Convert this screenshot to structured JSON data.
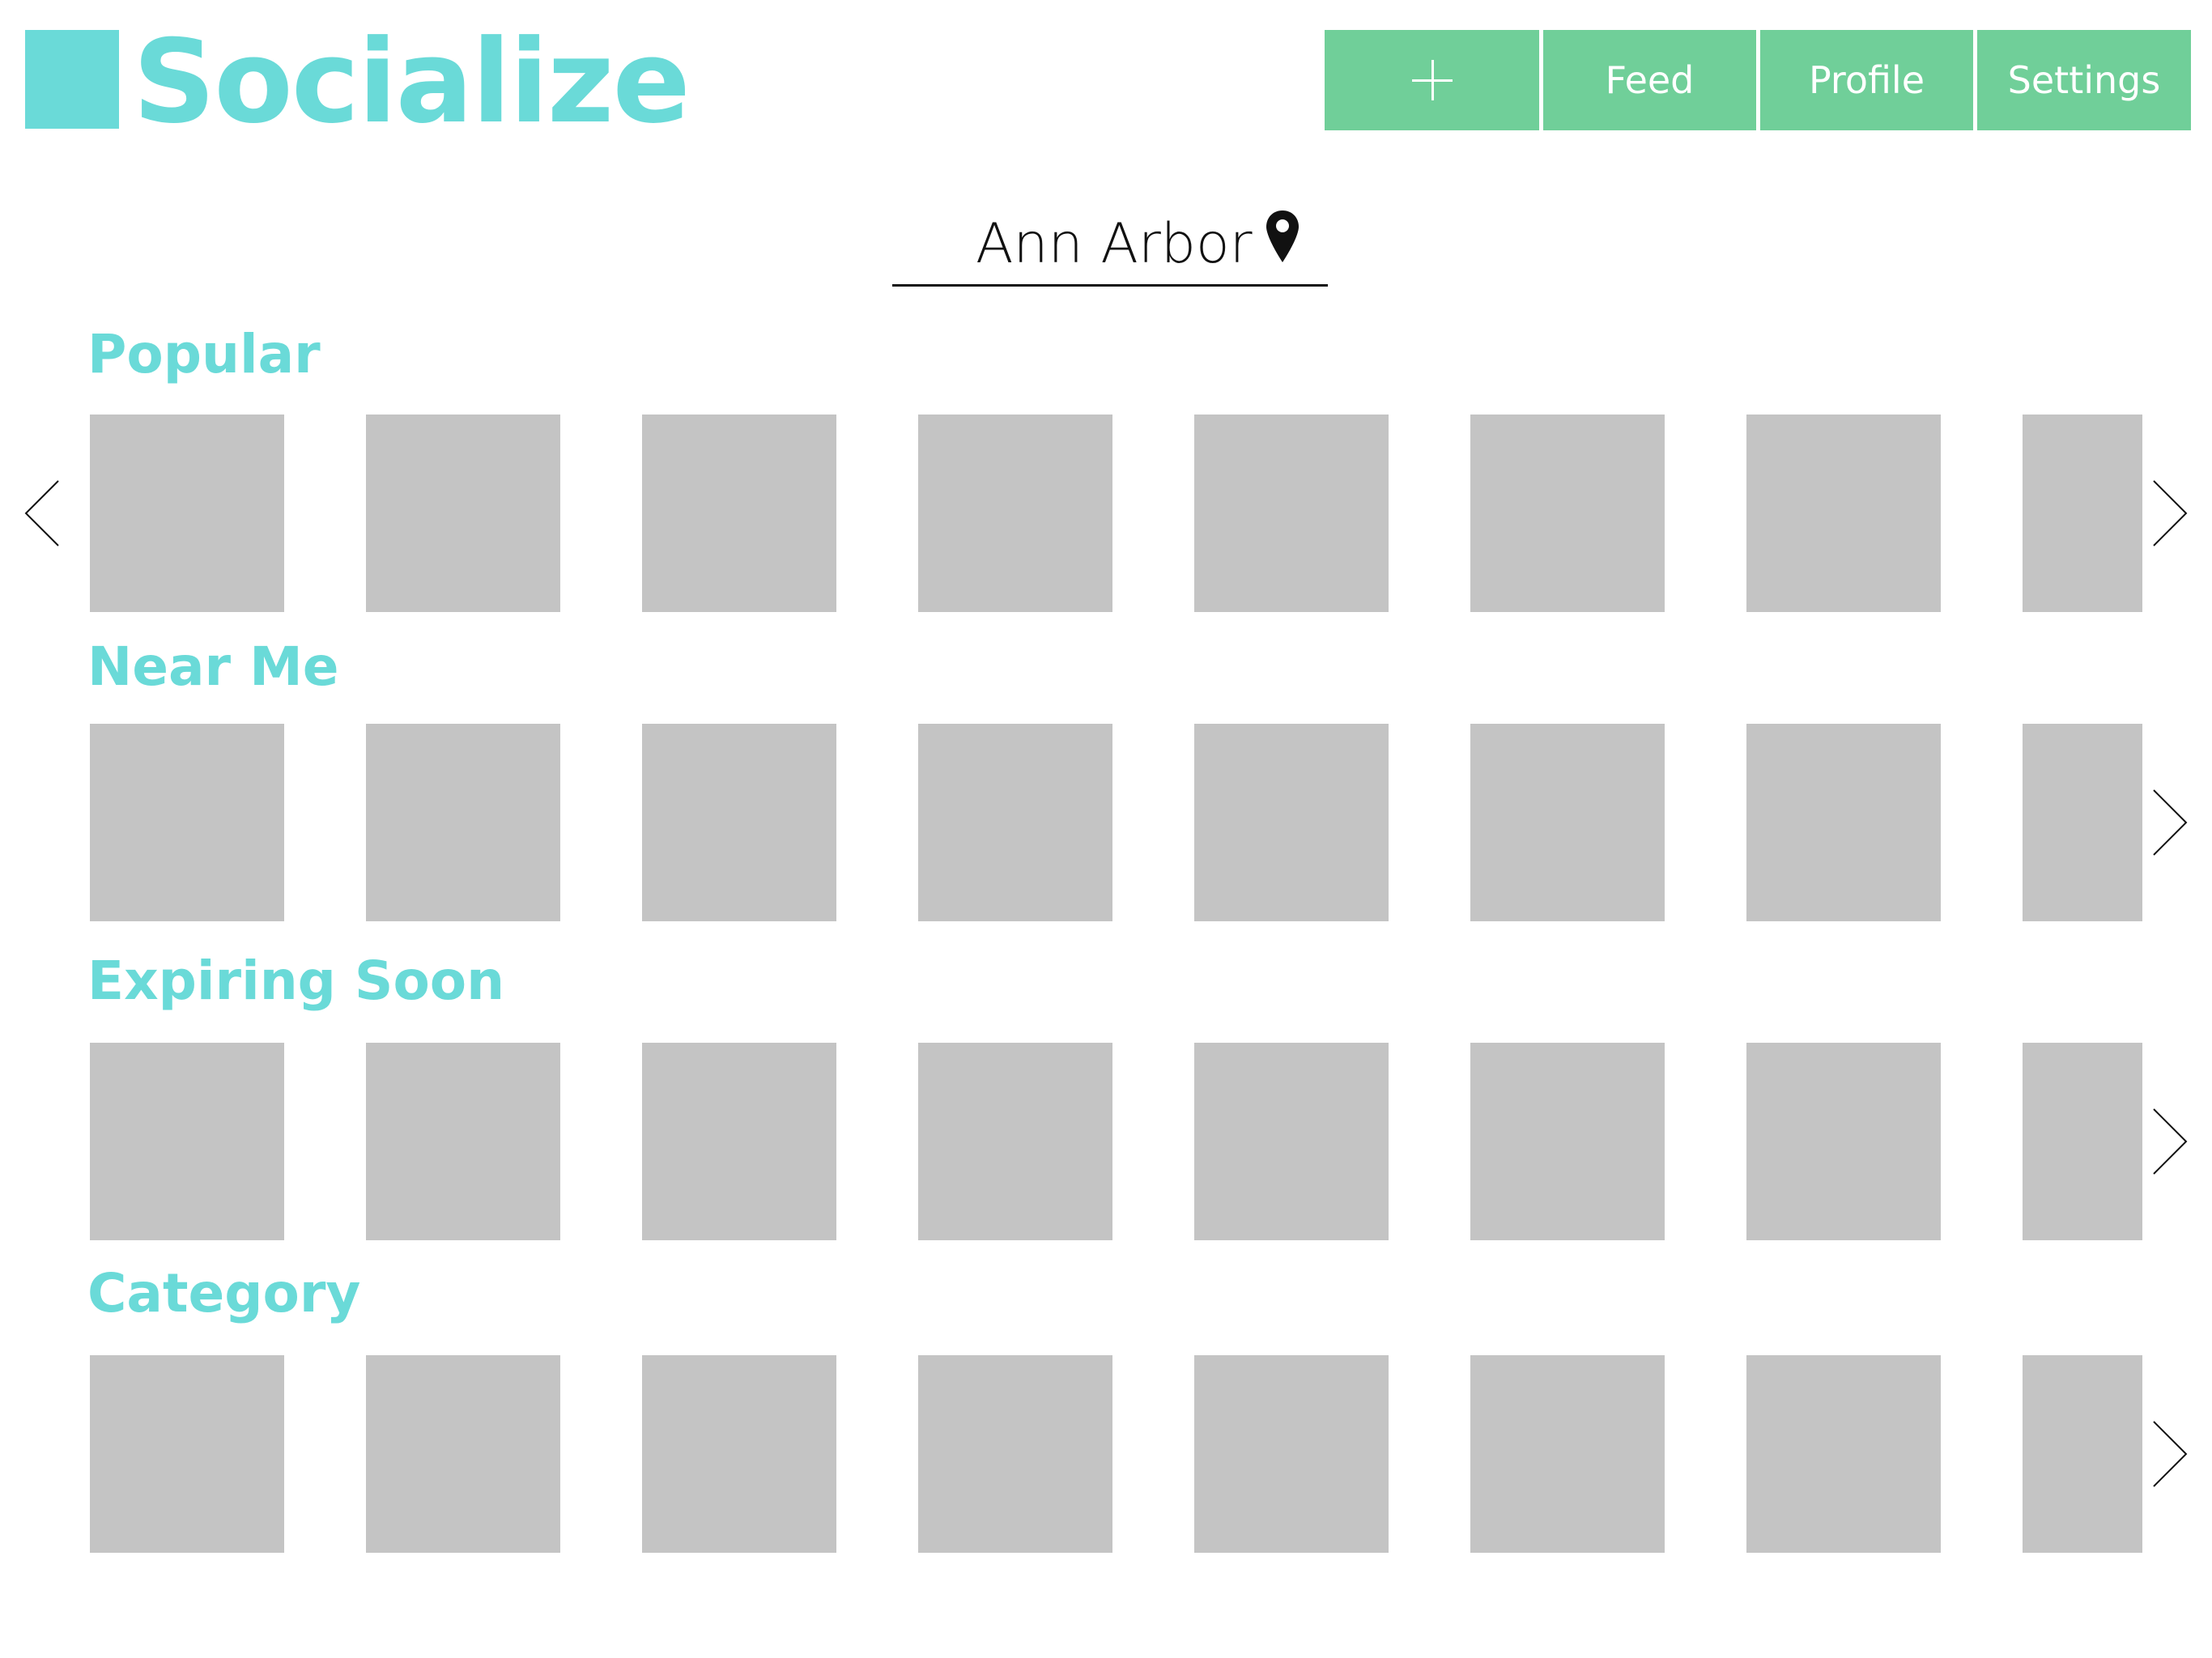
{
  "header": {
    "title": "Socialize",
    "brand_color": "#6adad8"
  },
  "nav": {
    "add_icon": "plus-icon",
    "feed_label": "Feed",
    "profile_label": "Profile",
    "settings_label": "Settings",
    "button_color": "#70cf99"
  },
  "location": {
    "value": "Ann Arbor",
    "icon": "map-pin-icon"
  },
  "sections": [
    {
      "title": "Popular",
      "tile_count": 8,
      "has_prev": true,
      "has_next": true
    },
    {
      "title": "Near Me",
      "tile_count": 8,
      "has_prev": false,
      "has_next": true
    },
    {
      "title": "Expiring Soon",
      "tile_count": 8,
      "has_prev": false,
      "has_next": true
    },
    {
      "title": "Category",
      "tile_count": 8,
      "has_prev": false,
      "has_next": true
    }
  ],
  "tile_color": "#c4c4c4"
}
